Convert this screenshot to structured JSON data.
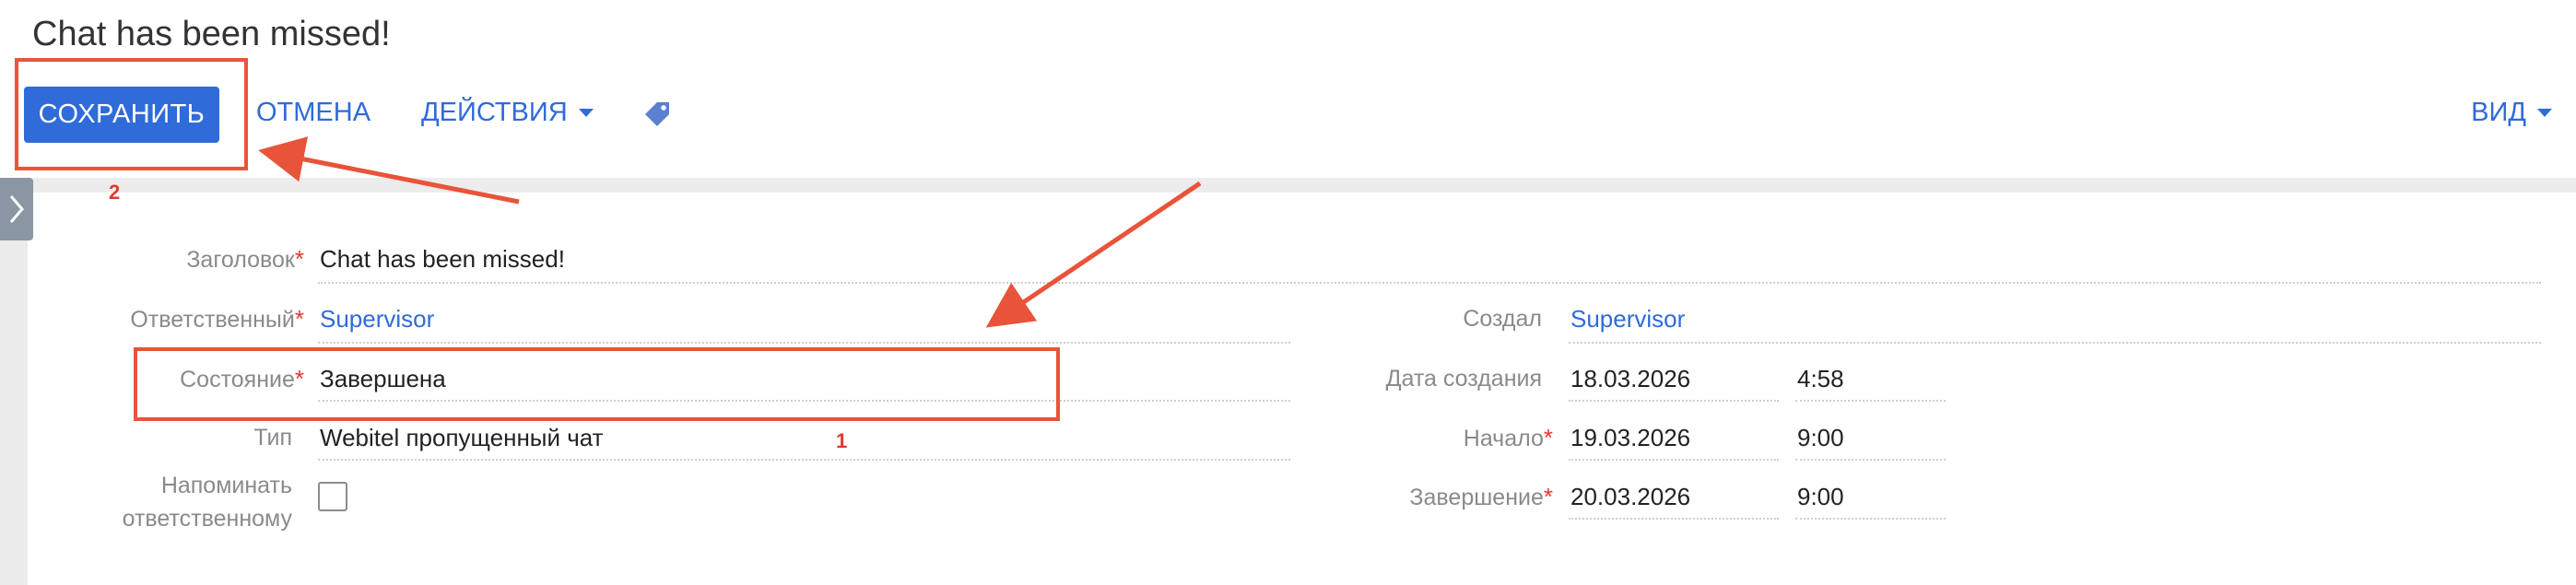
{
  "page": {
    "title": "Chat has been missed!"
  },
  "toolbar": {
    "save_label": "СОХРАНИТЬ",
    "cancel_label": "ОТМЕНА",
    "actions_label": "ДЕЙСТВИЯ",
    "view_label": "ВИД",
    "tag_icon": "tag-icon",
    "accent_color": "#2f6bd9"
  },
  "form": {
    "title_field": {
      "label": "Заголовок",
      "value": "Chat has been missed!"
    },
    "owner_field": {
      "label": "Ответственный",
      "value": "Supervisor"
    },
    "state_field": {
      "label": "Состояние",
      "value": "Завершена"
    },
    "type_field": {
      "label": "Тип",
      "value": "Webitel пропущенный чат"
    },
    "remind_field": {
      "label_line1": "Напоминать",
      "label_line2": "ответственному",
      "checked": false
    },
    "created_by_field": {
      "label": "Создал",
      "value": "Supervisor"
    },
    "created_date_field": {
      "label": "Дата создания",
      "date": "18.03.2026",
      "time": "4:58"
    },
    "start_field": {
      "label": "Начало",
      "date": "19.03.2026",
      "time": "9:00"
    },
    "end_field": {
      "label": "Завершение",
      "date": "20.03.2026",
      "time": "9:00"
    },
    "required_mark": "*"
  },
  "annotations": {
    "num1": "1",
    "num2": "2",
    "color": "#e8543a"
  }
}
